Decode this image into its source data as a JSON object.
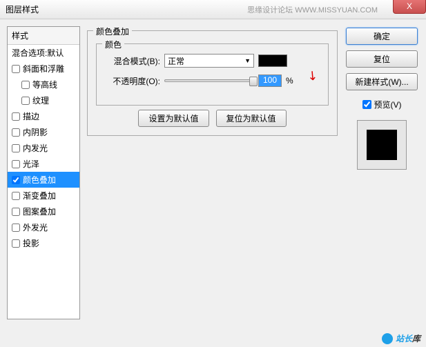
{
  "titlebar": {
    "title": "图层样式",
    "watermark": "思缘设计论坛  WWW.MISSYUAN.COM",
    "close": "X"
  },
  "styles": {
    "header": "样式",
    "blend_defaults": "混合选项:默认",
    "items": [
      {
        "label": "斜面和浮雕",
        "checked": false
      },
      {
        "label": "等高线",
        "checked": false,
        "indent": true
      },
      {
        "label": "纹理",
        "checked": false,
        "indent": true
      },
      {
        "label": "描边",
        "checked": false
      },
      {
        "label": "内阴影",
        "checked": false
      },
      {
        "label": "内发光",
        "checked": false
      },
      {
        "label": "光泽",
        "checked": false
      },
      {
        "label": "颜色叠加",
        "checked": true,
        "selected": true
      },
      {
        "label": "渐变叠加",
        "checked": false
      },
      {
        "label": "图案叠加",
        "checked": false
      },
      {
        "label": "外发光",
        "checked": false
      },
      {
        "label": "投影",
        "checked": false
      }
    ]
  },
  "panel": {
    "title": "颜色叠加",
    "group": "颜色",
    "blend_mode_label": "混合模式(B):",
    "blend_mode_value": "正常",
    "color": "#000000",
    "opacity_label": "不透明度(O):",
    "opacity_value": "100",
    "opacity_unit": "%",
    "set_default": "设置为默认值",
    "reset_default": "复位为默认值"
  },
  "right": {
    "ok": "确定",
    "cancel": "复位",
    "new_style": "新建样式(W)...",
    "preview": "预览(V)",
    "preview_checked": true
  },
  "footer": {
    "text1": "站长",
    "text2": "库"
  }
}
